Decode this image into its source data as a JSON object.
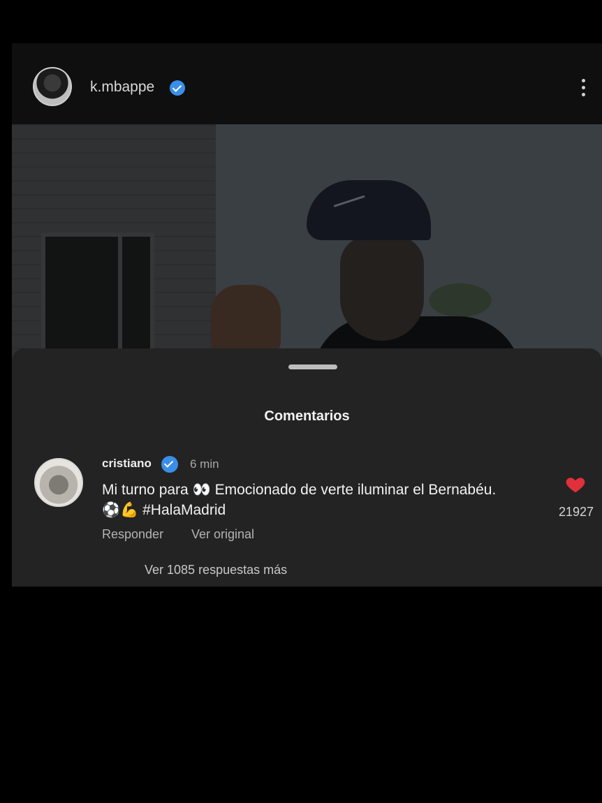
{
  "post": {
    "username": "k.mbappe",
    "verified": true,
    "avatar_icon": "profile-photo",
    "more_icon": "more-vertical-icon"
  },
  "comments_sheet": {
    "title": "Comentarios",
    "comment": {
      "username": "cristiano",
      "verified": true,
      "time": "6 min",
      "text_part1": "Mi turno para",
      "text_emoji1": "👀",
      "text_part2": " Emocionado de verte iluminar el Bernabéu.",
      "text_emoji2": "⚽💪",
      "text_part3": " #HalaMadrid",
      "like_count": "21927",
      "liked": true,
      "reply_label": "Responder",
      "original_label": "Ver original"
    },
    "more_replies_label": "Ver 1085 respuestas más"
  },
  "colors": {
    "background": "#000000",
    "sheet": "#232323",
    "verified": "#3b8ee8",
    "heart": "#e0303a"
  }
}
